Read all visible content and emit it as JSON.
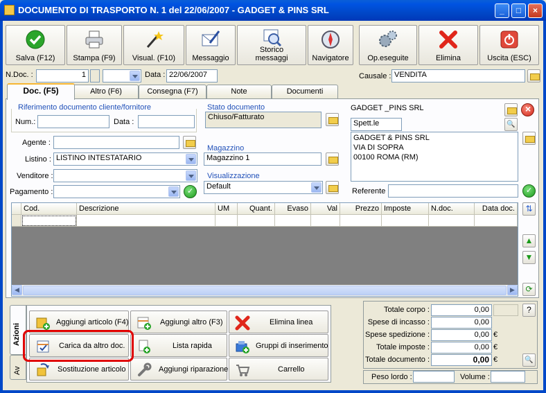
{
  "window": {
    "title": "DOCUMENTO DI TRASPORTO N. 1   del 22/06/2007 - GADGET & PINS SRL",
    "minimize": "_",
    "maximize": "□",
    "close": "×"
  },
  "toolbar": [
    {
      "label": "Salva (F12)",
      "icon": "save-icon"
    },
    {
      "label": "Stampa (F9)",
      "icon": "printer-icon"
    },
    {
      "label": "Visual. (F10)",
      "icon": "magic-wand-icon"
    },
    {
      "label": "Messaggio",
      "icon": "message-pen-icon"
    },
    {
      "label": "Storico\nmessaggi",
      "icon": "message-history-icon"
    },
    {
      "label": "Navigatore",
      "icon": "compass-icon"
    },
    {
      "label": "Op.eseguite",
      "icon": "gears-icon"
    },
    {
      "label": "Elimina",
      "icon": "delete-x-icon"
    },
    {
      "label": "Uscita (ESC)",
      "icon": "exit-icon"
    }
  ],
  "header": {
    "ndoc_label": "N.Doc. :",
    "ndoc_value": "1",
    "data_label": "Data :",
    "data_value": "22/06/2007",
    "causale_label": "Causale :",
    "causale_value": "VENDITA"
  },
  "tabs": [
    {
      "label": "Doc. (F5)",
      "active": true
    },
    {
      "label": "Altro (F6)"
    },
    {
      "label": "Consegna (F7)"
    },
    {
      "label": "Note"
    },
    {
      "label": "Documenti"
    }
  ],
  "doc": {
    "rif_group": "Riferimento documento cliente/fornitore",
    "num_label": "Num.:",
    "num_value": "",
    "data_label": "Data :",
    "data_value": "",
    "agente_label": "Agente :",
    "agente_value": "",
    "listino_label": "Listino :",
    "listino_value": "LISTINO INTESTATARIO",
    "venditore_label": "Venditore :",
    "venditore_value": "",
    "pagamento_label": "Pagamento :",
    "pagamento_value": "",
    "stato_group": "Stato documento",
    "stato_value": "Chiuso/Fatturato",
    "magazzino_group": "Magazzino",
    "magazzino_value": "Magazzino 1",
    "visual_group": "Visualizzazione",
    "visual_value": "Default",
    "cliente_name": "GADGET _PINS SRL",
    "spett": "Spett.le",
    "address_lines": [
      "GADGET & PINS SRL",
      "VIA DI SOPRA",
      "00100 ROMA (RM)"
    ],
    "referente_label": "Referente",
    "referente_value": ""
  },
  "grid": {
    "columns": [
      "Cod.",
      "Descrizione",
      "UM",
      "Quant.",
      "Evaso",
      "Val",
      "Prezzo",
      "Imposte",
      "N.doc.",
      "Data doc."
    ]
  },
  "side_tabs": [
    "Azioni",
    "Av"
  ],
  "actions": [
    {
      "label": "Aggiungi articolo (F4)",
      "icon": "add-article-icon"
    },
    {
      "label": "Aggiungi altro (F3)",
      "icon": "add-other-icon"
    },
    {
      "label": "Elimina linea",
      "icon": "delete-line-icon"
    },
    {
      "label": "Carica da altro doc.",
      "icon": "load-from-doc-icon"
    },
    {
      "label": "Lista rapida",
      "icon": "quick-list-icon"
    },
    {
      "label": "Gruppi di inserimento",
      "icon": "insert-groups-icon"
    },
    {
      "label": "Sostituzione articolo",
      "icon": "replace-article-icon"
    },
    {
      "label": "Aggiungi riparazione",
      "icon": "wrench-icon"
    },
    {
      "label": "Carrello",
      "icon": "cart-icon"
    }
  ],
  "totals": [
    {
      "label": "Totale corpo :",
      "value": "0,00",
      "unit": ""
    },
    {
      "label": "Spese di incasso :",
      "value": "0,00",
      "unit": ""
    },
    {
      "label": "Spese spedizione :",
      "value": "0,00",
      "unit": "€"
    },
    {
      "label": "Totale imposte :",
      "value": "0,00",
      "unit": "€"
    },
    {
      "label": "Totale documento :",
      "value": "0,00",
      "unit": "€"
    }
  ],
  "help": "?",
  "peso_label": "Peso lordo :",
  "peso_value": "",
  "volume_label": "Volume :",
  "volume_value": "",
  "colors": {
    "titlebar": "#0053E1",
    "highlight": "#E00000",
    "panel": "#ECE9D8"
  }
}
